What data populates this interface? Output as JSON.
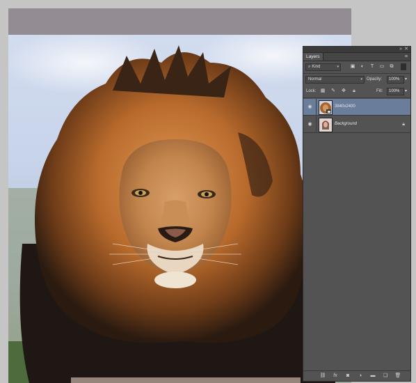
{
  "document": {
    "layers_panel": {
      "tab_label": "Layers",
      "collapse_icon": "double-chevron-icon",
      "close_icon": "close-icon",
      "menu_icon": "panel-menu-icon",
      "filter": {
        "kind_label": "Kind",
        "search_icon": "search-icon"
      },
      "filter_icons": [
        "image-filter-icon",
        "adjustment-filter-icon",
        "type-filter-icon",
        "shape-filter-icon",
        "smart-object-filter-icon",
        "filter-toggle-icon"
      ],
      "blend_mode": "Normal",
      "opacity_label": "Opacity:",
      "opacity_value": "100%",
      "lock_label": "Lock:",
      "lock_icons": [
        "lock-transparent-icon",
        "lock-image-icon",
        "lock-position-icon",
        "lock-all-icon"
      ],
      "fill_label": "Fill:",
      "fill_value": "100%",
      "layers": [
        {
          "name": "3840x2400",
          "selected": true,
          "visible": true,
          "smart_object": true,
          "locked": false
        },
        {
          "name": "Background",
          "selected": false,
          "visible": true,
          "smart_object": false,
          "locked": true
        }
      ],
      "bottom_icons": [
        "link-layers-icon",
        "fx-icon",
        "add-mask-icon",
        "adjustment-layer-icon",
        "new-group-icon",
        "new-layer-icon",
        "trash-icon"
      ],
      "bottom_glyphs": [
        "fx"
      ]
    }
  },
  "colors": {
    "panel_bg": "#535353",
    "selected_layer": "#6a7e9b",
    "app_bg": "#c5c5c5"
  }
}
